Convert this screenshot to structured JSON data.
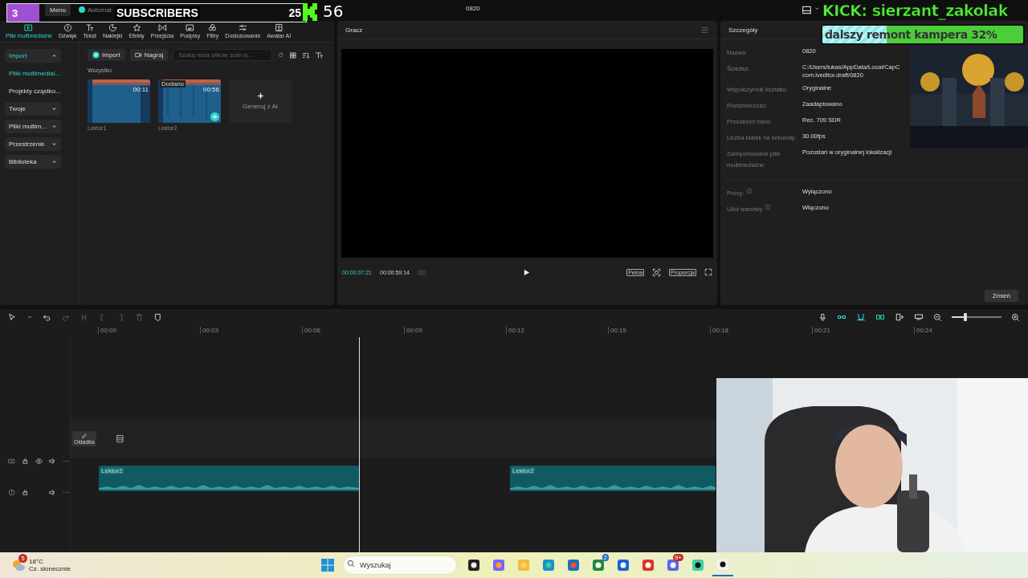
{
  "top_bar": {
    "menu": "Menu",
    "autosave": "Automat",
    "title": "0820"
  },
  "tool_tabs": [
    {
      "label": "Pliki multimedialne",
      "selected": true,
      "kind": "media"
    },
    {
      "label": "Dźwięk",
      "selected": false,
      "kind": "audio"
    },
    {
      "label": "Tekst",
      "selected": false,
      "kind": "text"
    },
    {
      "label": "Naklejki",
      "selected": false,
      "kind": "sticker"
    },
    {
      "label": "Efekty",
      "selected": false,
      "kind": "effects"
    },
    {
      "label": "Przejścia",
      "selected": false,
      "kind": "transitions"
    },
    {
      "label": "Podpisy",
      "selected": false,
      "kind": "captions"
    },
    {
      "label": "Filtry",
      "selected": false,
      "kind": "filters"
    },
    {
      "label": "Dostosowanie",
      "selected": false,
      "kind": "adjust"
    },
    {
      "label": "Awatar AI",
      "selected": false,
      "kind": "avatar"
    }
  ],
  "sidebar": {
    "items": [
      {
        "label": "Import",
        "kind": "group",
        "expanded": true,
        "selected": false
      },
      {
        "label": "Pliki multimedial...",
        "kind": "sub",
        "selected": true
      },
      {
        "label": "Projekty cząstko...",
        "kind": "sub",
        "selected": false
      },
      {
        "label": "Twoje",
        "kind": "group",
        "expanded": false,
        "selected": false
      },
      {
        "label": "Pliki multim...",
        "kind": "group",
        "expanded": false,
        "selected": false
      },
      {
        "label": "Przestrzenie",
        "kind": "group",
        "expanded": false,
        "selected": false
      },
      {
        "label": "Biblioteka",
        "kind": "group",
        "expanded": false,
        "selected": false
      }
    ]
  },
  "media": {
    "import_button": "Import",
    "record_button": "Nagraj",
    "search": {
      "placeholder": "Szukaj nazw plików, scen lu…"
    },
    "section": "Wszystko",
    "items": [
      {
        "name": "Lektor1",
        "duration": "00:11",
        "hovered": false
      },
      {
        "name": "Lektor2",
        "duration": "00:56",
        "badge": "Dodano",
        "hovered": true
      }
    ],
    "ai_card": "Generuj z AI"
  },
  "player": {
    "title": "Gracz",
    "current_time": "00:00:07:21",
    "total_time": "00:00:59:14",
    "full_button": "Pełna",
    "ratio_button": "Proporcja"
  },
  "details": {
    "title": "Szczegóły",
    "rows": [
      {
        "label": "Nazwa:",
        "value": "0820"
      },
      {
        "label": "Ścieżka:",
        "value": "C:/Users/lukas/AppData/Local/CapC\ncom.lveditor.draft/0820"
      },
      {
        "label": "Współczynnik kształtu:",
        "value": "Oryginalne"
      },
      {
        "label": "Rozdzielczość:",
        "value": "Zaadaptowano"
      },
      {
        "label": "Przestrzeń barw",
        "value": "Rec. 709 SDR"
      },
      {
        "label": "Liczba klatek na sekundę:",
        "value": "30.00fps"
      },
      {
        "label": "Zaimportowane pliki multimedialne:",
        "value": "Pozostań w oryginalnej lokalizacji"
      }
    ],
    "settings": [
      {
        "label": "Proxy:",
        "value": "Wyłączono"
      },
      {
        "label": "Ułóż warstwy",
        "value": "Włączono"
      }
    ],
    "change_button": "Zmień"
  },
  "timeline": {
    "zoom": {
      "level": 0.27
    },
    "ruler": [
      "00:00",
      "00:03",
      "00:06",
      "00:09",
      "00:12",
      "00:15",
      "00:18",
      "00:21",
      "00:24"
    ],
    "cover_button": "Okładka",
    "clips": [
      {
        "label": "Lektor2"
      },
      {
        "label": "Lektor2"
      }
    ]
  },
  "overlays": {
    "subscribers": {
      "count": "3",
      "label": "SUBSCRIBERS",
      "goal": "25",
      "total": "56"
    },
    "kick": {
      "title": "KICK: sierzant_zakolak",
      "goal": {
        "label": "dalszy remont kampera 32%",
        "level": 0.32
      }
    }
  },
  "taskbar": {
    "weather": {
      "badge": "5",
      "temperature": "18°C",
      "condition": "Cz. słonecznie"
    },
    "search": {
      "placeholder": "Wyszukaj"
    },
    "apps": [
      {
        "kind": "taskview",
        "selected": false
      },
      {
        "kind": "copilot",
        "selected": false
      },
      {
        "kind": "folder",
        "selected": false
      },
      {
        "kind": "edge",
        "selected": false
      },
      {
        "kind": "store",
        "selected": false
      },
      {
        "kind": "xbox",
        "badge": "2",
        "selected": false
      },
      {
        "kind": "editor",
        "selected": false
      },
      {
        "kind": "opera",
        "selected": false
      },
      {
        "kind": "discord",
        "badge": "9+",
        "selected": false
      },
      {
        "kind": "chat",
        "selected": false
      },
      {
        "kind": "capcut",
        "selected": true
      }
    ]
  }
}
